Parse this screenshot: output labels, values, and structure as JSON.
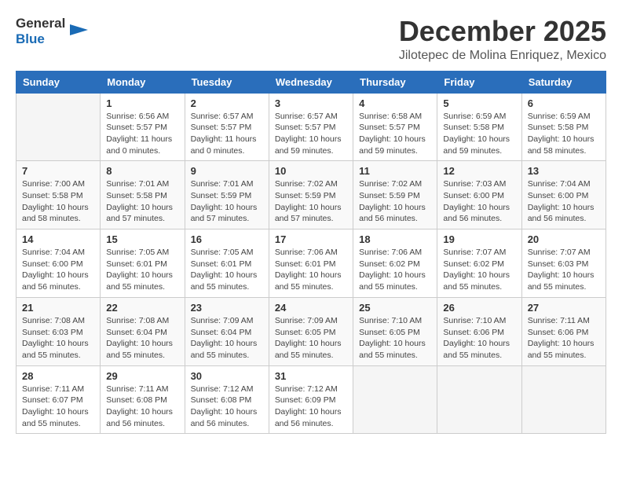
{
  "logo": {
    "general": "General",
    "blue": "Blue"
  },
  "title": "December 2025",
  "location": "Jilotepec de Molina Enriquez, Mexico",
  "weekdays": [
    "Sunday",
    "Monday",
    "Tuesday",
    "Wednesday",
    "Thursday",
    "Friday",
    "Saturday"
  ],
  "weeks": [
    [
      {
        "day": "",
        "info": ""
      },
      {
        "day": "1",
        "info": "Sunrise: 6:56 AM\nSunset: 5:57 PM\nDaylight: 11 hours\nand 0 minutes."
      },
      {
        "day": "2",
        "info": "Sunrise: 6:57 AM\nSunset: 5:57 PM\nDaylight: 11 hours\nand 0 minutes."
      },
      {
        "day": "3",
        "info": "Sunrise: 6:57 AM\nSunset: 5:57 PM\nDaylight: 10 hours\nand 59 minutes."
      },
      {
        "day": "4",
        "info": "Sunrise: 6:58 AM\nSunset: 5:57 PM\nDaylight: 10 hours\nand 59 minutes."
      },
      {
        "day": "5",
        "info": "Sunrise: 6:59 AM\nSunset: 5:58 PM\nDaylight: 10 hours\nand 59 minutes."
      },
      {
        "day": "6",
        "info": "Sunrise: 6:59 AM\nSunset: 5:58 PM\nDaylight: 10 hours\nand 58 minutes."
      }
    ],
    [
      {
        "day": "7",
        "info": "Sunrise: 7:00 AM\nSunset: 5:58 PM\nDaylight: 10 hours\nand 58 minutes."
      },
      {
        "day": "8",
        "info": "Sunrise: 7:01 AM\nSunset: 5:58 PM\nDaylight: 10 hours\nand 57 minutes."
      },
      {
        "day": "9",
        "info": "Sunrise: 7:01 AM\nSunset: 5:59 PM\nDaylight: 10 hours\nand 57 minutes."
      },
      {
        "day": "10",
        "info": "Sunrise: 7:02 AM\nSunset: 5:59 PM\nDaylight: 10 hours\nand 57 minutes."
      },
      {
        "day": "11",
        "info": "Sunrise: 7:02 AM\nSunset: 5:59 PM\nDaylight: 10 hours\nand 56 minutes."
      },
      {
        "day": "12",
        "info": "Sunrise: 7:03 AM\nSunset: 6:00 PM\nDaylight: 10 hours\nand 56 minutes."
      },
      {
        "day": "13",
        "info": "Sunrise: 7:04 AM\nSunset: 6:00 PM\nDaylight: 10 hours\nand 56 minutes."
      }
    ],
    [
      {
        "day": "14",
        "info": "Sunrise: 7:04 AM\nSunset: 6:00 PM\nDaylight: 10 hours\nand 56 minutes."
      },
      {
        "day": "15",
        "info": "Sunrise: 7:05 AM\nSunset: 6:01 PM\nDaylight: 10 hours\nand 55 minutes."
      },
      {
        "day": "16",
        "info": "Sunrise: 7:05 AM\nSunset: 6:01 PM\nDaylight: 10 hours\nand 55 minutes."
      },
      {
        "day": "17",
        "info": "Sunrise: 7:06 AM\nSunset: 6:01 PM\nDaylight: 10 hours\nand 55 minutes."
      },
      {
        "day": "18",
        "info": "Sunrise: 7:06 AM\nSunset: 6:02 PM\nDaylight: 10 hours\nand 55 minutes."
      },
      {
        "day": "19",
        "info": "Sunrise: 7:07 AM\nSunset: 6:02 PM\nDaylight: 10 hours\nand 55 minutes."
      },
      {
        "day": "20",
        "info": "Sunrise: 7:07 AM\nSunset: 6:03 PM\nDaylight: 10 hours\nand 55 minutes."
      }
    ],
    [
      {
        "day": "21",
        "info": "Sunrise: 7:08 AM\nSunset: 6:03 PM\nDaylight: 10 hours\nand 55 minutes."
      },
      {
        "day": "22",
        "info": "Sunrise: 7:08 AM\nSunset: 6:04 PM\nDaylight: 10 hours\nand 55 minutes."
      },
      {
        "day": "23",
        "info": "Sunrise: 7:09 AM\nSunset: 6:04 PM\nDaylight: 10 hours\nand 55 minutes."
      },
      {
        "day": "24",
        "info": "Sunrise: 7:09 AM\nSunset: 6:05 PM\nDaylight: 10 hours\nand 55 minutes."
      },
      {
        "day": "25",
        "info": "Sunrise: 7:10 AM\nSunset: 6:05 PM\nDaylight: 10 hours\nand 55 minutes."
      },
      {
        "day": "26",
        "info": "Sunrise: 7:10 AM\nSunset: 6:06 PM\nDaylight: 10 hours\nand 55 minutes."
      },
      {
        "day": "27",
        "info": "Sunrise: 7:11 AM\nSunset: 6:06 PM\nDaylight: 10 hours\nand 55 minutes."
      }
    ],
    [
      {
        "day": "28",
        "info": "Sunrise: 7:11 AM\nSunset: 6:07 PM\nDaylight: 10 hours\nand 55 minutes."
      },
      {
        "day": "29",
        "info": "Sunrise: 7:11 AM\nSunset: 6:08 PM\nDaylight: 10 hours\nand 56 minutes."
      },
      {
        "day": "30",
        "info": "Sunrise: 7:12 AM\nSunset: 6:08 PM\nDaylight: 10 hours\nand 56 minutes."
      },
      {
        "day": "31",
        "info": "Sunrise: 7:12 AM\nSunset: 6:09 PM\nDaylight: 10 hours\nand 56 minutes."
      },
      {
        "day": "",
        "info": ""
      },
      {
        "day": "",
        "info": ""
      },
      {
        "day": "",
        "info": ""
      }
    ]
  ]
}
